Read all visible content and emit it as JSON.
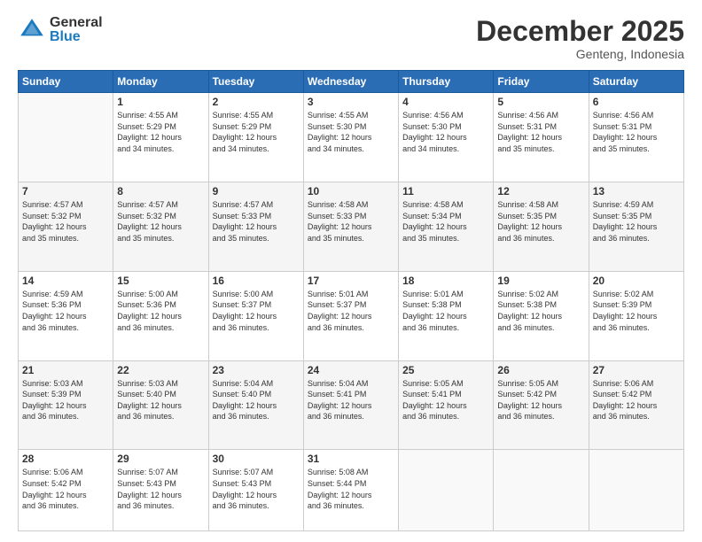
{
  "logo": {
    "general": "General",
    "blue": "Blue"
  },
  "header": {
    "month": "December 2025",
    "location": "Genteng, Indonesia"
  },
  "weekdays": [
    "Sunday",
    "Monday",
    "Tuesday",
    "Wednesday",
    "Thursday",
    "Friday",
    "Saturday"
  ],
  "weeks": [
    [
      {
        "day": "",
        "info": ""
      },
      {
        "day": "1",
        "info": "Sunrise: 4:55 AM\nSunset: 5:29 PM\nDaylight: 12 hours\nand 34 minutes."
      },
      {
        "day": "2",
        "info": "Sunrise: 4:55 AM\nSunset: 5:29 PM\nDaylight: 12 hours\nand 34 minutes."
      },
      {
        "day": "3",
        "info": "Sunrise: 4:55 AM\nSunset: 5:30 PM\nDaylight: 12 hours\nand 34 minutes."
      },
      {
        "day": "4",
        "info": "Sunrise: 4:56 AM\nSunset: 5:30 PM\nDaylight: 12 hours\nand 34 minutes."
      },
      {
        "day": "5",
        "info": "Sunrise: 4:56 AM\nSunset: 5:31 PM\nDaylight: 12 hours\nand 35 minutes."
      },
      {
        "day": "6",
        "info": "Sunrise: 4:56 AM\nSunset: 5:31 PM\nDaylight: 12 hours\nand 35 minutes."
      }
    ],
    [
      {
        "day": "7",
        "info": "Sunrise: 4:57 AM\nSunset: 5:32 PM\nDaylight: 12 hours\nand 35 minutes."
      },
      {
        "day": "8",
        "info": "Sunrise: 4:57 AM\nSunset: 5:32 PM\nDaylight: 12 hours\nand 35 minutes."
      },
      {
        "day": "9",
        "info": "Sunrise: 4:57 AM\nSunset: 5:33 PM\nDaylight: 12 hours\nand 35 minutes."
      },
      {
        "day": "10",
        "info": "Sunrise: 4:58 AM\nSunset: 5:33 PM\nDaylight: 12 hours\nand 35 minutes."
      },
      {
        "day": "11",
        "info": "Sunrise: 4:58 AM\nSunset: 5:34 PM\nDaylight: 12 hours\nand 35 minutes."
      },
      {
        "day": "12",
        "info": "Sunrise: 4:58 AM\nSunset: 5:35 PM\nDaylight: 12 hours\nand 36 minutes."
      },
      {
        "day": "13",
        "info": "Sunrise: 4:59 AM\nSunset: 5:35 PM\nDaylight: 12 hours\nand 36 minutes."
      }
    ],
    [
      {
        "day": "14",
        "info": "Sunrise: 4:59 AM\nSunset: 5:36 PM\nDaylight: 12 hours\nand 36 minutes."
      },
      {
        "day": "15",
        "info": "Sunrise: 5:00 AM\nSunset: 5:36 PM\nDaylight: 12 hours\nand 36 minutes."
      },
      {
        "day": "16",
        "info": "Sunrise: 5:00 AM\nSunset: 5:37 PM\nDaylight: 12 hours\nand 36 minutes."
      },
      {
        "day": "17",
        "info": "Sunrise: 5:01 AM\nSunset: 5:37 PM\nDaylight: 12 hours\nand 36 minutes."
      },
      {
        "day": "18",
        "info": "Sunrise: 5:01 AM\nSunset: 5:38 PM\nDaylight: 12 hours\nand 36 minutes."
      },
      {
        "day": "19",
        "info": "Sunrise: 5:02 AM\nSunset: 5:38 PM\nDaylight: 12 hours\nand 36 minutes."
      },
      {
        "day": "20",
        "info": "Sunrise: 5:02 AM\nSunset: 5:39 PM\nDaylight: 12 hours\nand 36 minutes."
      }
    ],
    [
      {
        "day": "21",
        "info": "Sunrise: 5:03 AM\nSunset: 5:39 PM\nDaylight: 12 hours\nand 36 minutes."
      },
      {
        "day": "22",
        "info": "Sunrise: 5:03 AM\nSunset: 5:40 PM\nDaylight: 12 hours\nand 36 minutes."
      },
      {
        "day": "23",
        "info": "Sunrise: 5:04 AM\nSunset: 5:40 PM\nDaylight: 12 hours\nand 36 minutes."
      },
      {
        "day": "24",
        "info": "Sunrise: 5:04 AM\nSunset: 5:41 PM\nDaylight: 12 hours\nand 36 minutes."
      },
      {
        "day": "25",
        "info": "Sunrise: 5:05 AM\nSunset: 5:41 PM\nDaylight: 12 hours\nand 36 minutes."
      },
      {
        "day": "26",
        "info": "Sunrise: 5:05 AM\nSunset: 5:42 PM\nDaylight: 12 hours\nand 36 minutes."
      },
      {
        "day": "27",
        "info": "Sunrise: 5:06 AM\nSunset: 5:42 PM\nDaylight: 12 hours\nand 36 minutes."
      }
    ],
    [
      {
        "day": "28",
        "info": "Sunrise: 5:06 AM\nSunset: 5:42 PM\nDaylight: 12 hours\nand 36 minutes."
      },
      {
        "day": "29",
        "info": "Sunrise: 5:07 AM\nSunset: 5:43 PM\nDaylight: 12 hours\nand 36 minutes."
      },
      {
        "day": "30",
        "info": "Sunrise: 5:07 AM\nSunset: 5:43 PM\nDaylight: 12 hours\nand 36 minutes."
      },
      {
        "day": "31",
        "info": "Sunrise: 5:08 AM\nSunset: 5:44 PM\nDaylight: 12 hours\nand 36 minutes."
      },
      {
        "day": "",
        "info": ""
      },
      {
        "day": "",
        "info": ""
      },
      {
        "day": "",
        "info": ""
      }
    ]
  ]
}
